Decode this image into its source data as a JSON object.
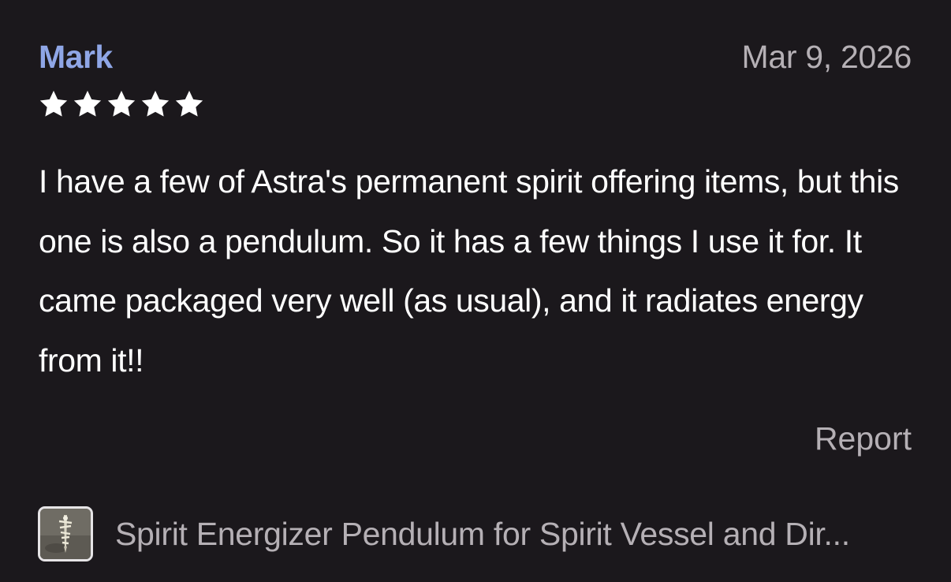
{
  "review": {
    "reviewer": "Mark",
    "date": "Mar 9, 2026",
    "rating": 5,
    "rating_max": 5,
    "text": "I have a few of Astra's permanent spirit offering items, but this one is also a pendulum. So it has a few things I use it for. It came packaged very well (as usual), and it radiates energy from it!!",
    "report_label": "Report"
  },
  "product": {
    "title": "Spirit Energizer Pendulum for Spirit Vessel and Dir...",
    "thumbnail_icon": "pendulum-product-thumbnail"
  },
  "colors": {
    "background": "#1b181c",
    "reviewer_name": "#8fa6e6",
    "muted_text": "#b5b0b5",
    "body_text": "#ffffff",
    "star": "#ffffff"
  }
}
